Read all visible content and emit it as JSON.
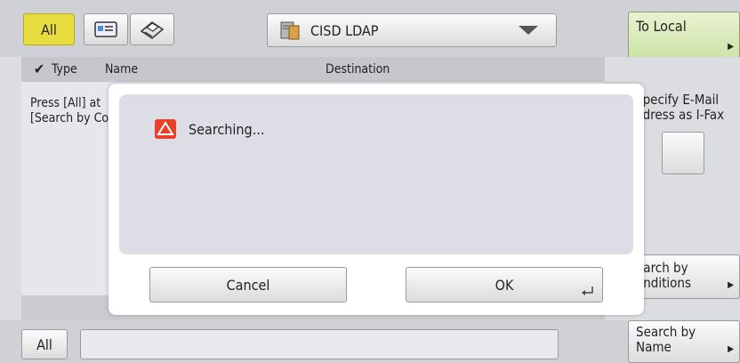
{
  "topbar": {
    "all_label": "All",
    "address_book_icon": "address-book-icon",
    "fax_icon": "fax-icon"
  },
  "source_dropdown": {
    "value": "CISD LDAP",
    "icon": "ldap-server-icon"
  },
  "to_local_label": "To Local",
  "table_header": {
    "type": "Type",
    "name": "Name",
    "destination": "Destination"
  },
  "list_message": {
    "line1": "Press [All] at",
    "line2": "[Search by Co"
  },
  "side": {
    "specify_line1": "Specify E-Mail",
    "specify_line2": "ddress as I-Fax",
    "search_cond_line1": "earch by",
    "search_cond_line2": "onditions",
    "search_name_line1": "Search by",
    "search_name_line2": "Name"
  },
  "bottom": {
    "all_label": "All",
    "search_value": ""
  },
  "dialog": {
    "message": "Searching...",
    "cancel_label": "Cancel",
    "ok_label": "OK",
    "warn_icon": "warning-icon"
  },
  "colors": {
    "all_active": "#e8dd3f",
    "to_local": "#d9eab8",
    "warning": "#e8402a"
  }
}
